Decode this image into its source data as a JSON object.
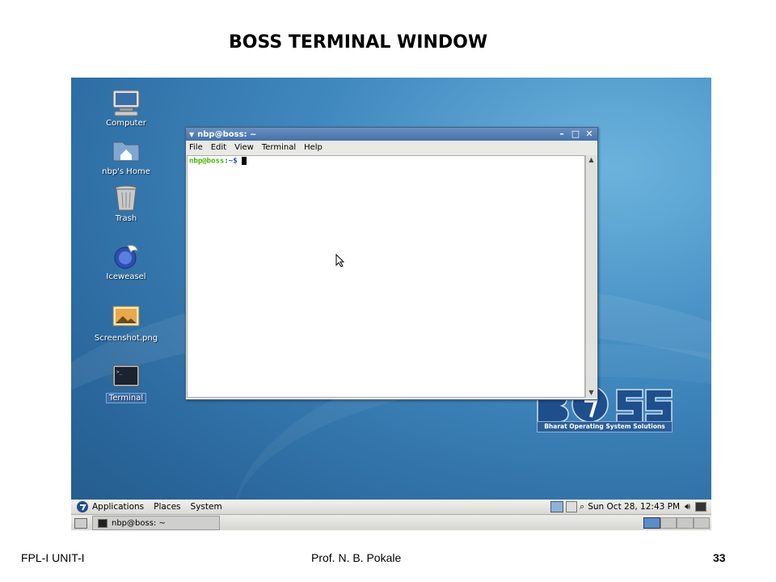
{
  "slide": {
    "title": "BOSS TERMINAL WINDOW",
    "footer_left": "FPL-I  UNIT-I",
    "footer_center": "Prof. N. B. Pokale",
    "footer_page": "33"
  },
  "desktop": {
    "icons": [
      {
        "label": "Computer",
        "icon": "computer-icon"
      },
      {
        "label": "nbp's Home",
        "icon": "home-folder-icon"
      },
      {
        "label": "Trash",
        "icon": "trash-icon"
      },
      {
        "label": "Iceweasel",
        "icon": "iceweasel-icon"
      },
      {
        "label": "Screenshot.png",
        "icon": "image-file-icon"
      },
      {
        "label": "Terminal",
        "icon": "terminal-icon"
      }
    ],
    "logo_band_text": "Bharat Operating System Solutions"
  },
  "terminal": {
    "title": "nbp@boss: ~",
    "menu": [
      "File",
      "Edit",
      "View",
      "Terminal",
      "Help"
    ],
    "prompt_user": "nbp@boss",
    "prompt_path": ":~$"
  },
  "top_panel": {
    "menus": [
      "Applications",
      "Places",
      "System"
    ],
    "clock": "Sun Oct 28, 12:43 PM"
  },
  "bottom_panel": {
    "task": "nbp@boss: ~"
  },
  "colors": {
    "desktop_blue": "#3f88be",
    "titlebar_blue": "#4572aa",
    "prompt_green": "#4bb000",
    "prompt_blue": "#2052c0"
  }
}
